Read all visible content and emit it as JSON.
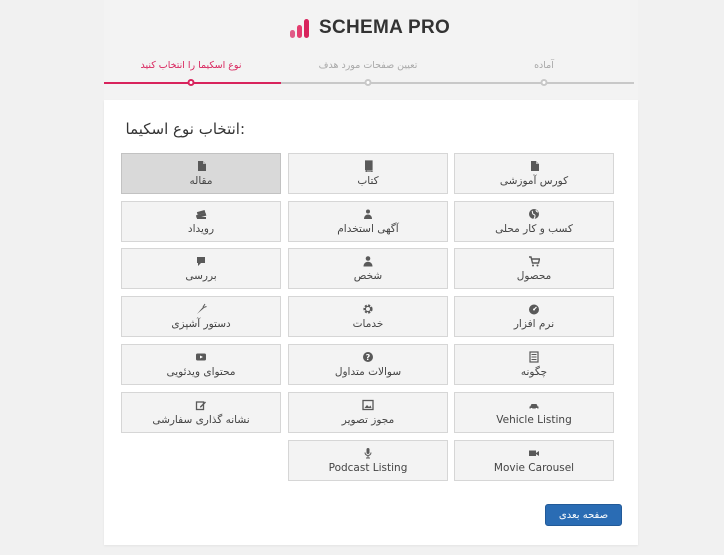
{
  "app": {
    "name": "SCHEMA PRO"
  },
  "colors": {
    "accent": "#d8235c",
    "button": "#2a6cb4",
    "inactive": "#c8c8c8"
  },
  "steps": [
    {
      "label": "آماده",
      "active": false
    },
    {
      "label": "تعیین صفحات مورد هدف",
      "active": false
    },
    {
      "label": "نوع اسکیما را انتخاب کنید",
      "active": true
    }
  ],
  "panel": {
    "title": ":انتخاب نوع اسکیما"
  },
  "tiles": [
    {
      "label": "کورس آموزشی",
      "icon": "file-icon"
    },
    {
      "label": "کتاب",
      "icon": "book-icon"
    },
    {
      "label": "مقاله",
      "icon": "file-icon",
      "selected": true
    },
    {
      "label": "کسب و کار محلی",
      "icon": "globe-icon"
    },
    {
      "label": "آگهی استخدام",
      "icon": "user-group-icon"
    },
    {
      "label": "رویداد",
      "icon": "ticket-icon"
    },
    {
      "label": "محصول",
      "icon": "cart-icon"
    },
    {
      "label": "شخص",
      "icon": "user-icon"
    },
    {
      "label": "بررسی",
      "icon": "comment-icon"
    },
    {
      "label": "نرم افزار",
      "icon": "dashboard-icon"
    },
    {
      "label": "خدمات",
      "icon": "gear-icon"
    },
    {
      "label": "دستور آشپزی",
      "icon": "carrot-icon"
    },
    {
      "label": "چگونه",
      "icon": "list-icon"
    },
    {
      "label": "سوالات متداول",
      "icon": "question-icon"
    },
    {
      "label": "محتوای ویدئویی",
      "icon": "video-play-icon"
    },
    {
      "label": "Vehicle Listing",
      "icon": "car-icon"
    },
    {
      "label": "مجوز تصویر",
      "icon": "image-icon"
    },
    {
      "label": "نشانه گذاری سفارشی",
      "icon": "edit-icon"
    },
    {
      "label": "Movie Carousel",
      "icon": "video-camera-icon"
    },
    {
      "label": "Podcast Listing",
      "icon": "microphone-icon"
    }
  ],
  "buttons": {
    "next": "صفحه بعدی"
  }
}
